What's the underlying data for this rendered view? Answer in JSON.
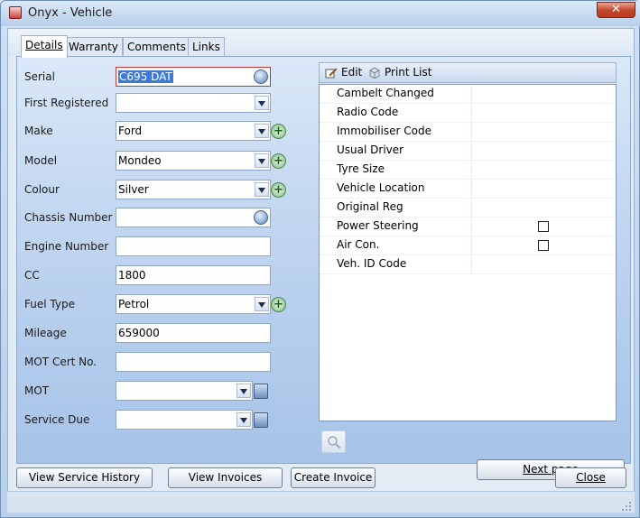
{
  "window": {
    "title": "Onyx - Vehicle",
    "close_glyph": "✕"
  },
  "tabs": [
    {
      "label": "Details",
      "active": true
    },
    {
      "label": "Warranty",
      "active": false
    },
    {
      "label": "Comments",
      "active": false
    },
    {
      "label": "Links",
      "active": false
    }
  ],
  "form": {
    "serial": {
      "label": "Serial",
      "value": "C695 DAT"
    },
    "first_registered": {
      "label": "First Registered",
      "value": ""
    },
    "make": {
      "label": "Make",
      "value": "Ford"
    },
    "model": {
      "label": "Model",
      "value": "Mondeo"
    },
    "colour": {
      "label": "Colour",
      "value": "Silver"
    },
    "chassis_number": {
      "label": "Chassis Number",
      "value": ""
    },
    "engine_number": {
      "label": "Engine Number",
      "value": ""
    },
    "cc": {
      "label": "CC",
      "value": "1800"
    },
    "fuel_type": {
      "label": "Fuel Type",
      "value": "Petrol"
    },
    "mileage": {
      "label": "Mileage",
      "value": "659000"
    },
    "mot_cert_no": {
      "label": "MOT Cert No.",
      "value": ""
    },
    "mot": {
      "label": "MOT",
      "value": ""
    },
    "service_due": {
      "label": "Service Due",
      "value": ""
    },
    "plus_glyph": "+"
  },
  "list_toolbar": {
    "edit": "Edit",
    "print_list": "Print List"
  },
  "list_items": [
    {
      "label": "Cambelt Changed"
    },
    {
      "label": "Radio Code"
    },
    {
      "label": "Immobiliser Code"
    },
    {
      "label": "Usual Driver"
    },
    {
      "label": "Tyre Size"
    },
    {
      "label": "Vehicle Location"
    },
    {
      "label": "Original Reg"
    },
    {
      "label": "Power Steering",
      "checkbox": true,
      "checked": false
    },
    {
      "label": "Air Con.",
      "checkbox": true,
      "checked": false
    },
    {
      "label": "Veh. ID Code"
    }
  ],
  "buttons": {
    "next_page": "Next page",
    "view_service_history": "View Service History",
    "view_invoices": "View Invoices",
    "create_invoice": "Create Invoice",
    "close": "Close"
  },
  "colors": {
    "accent": "#3d7ad6",
    "panel_top": "#dbe8f8",
    "panel_bottom": "#a6c3e8",
    "close_red": "#c2442a"
  }
}
